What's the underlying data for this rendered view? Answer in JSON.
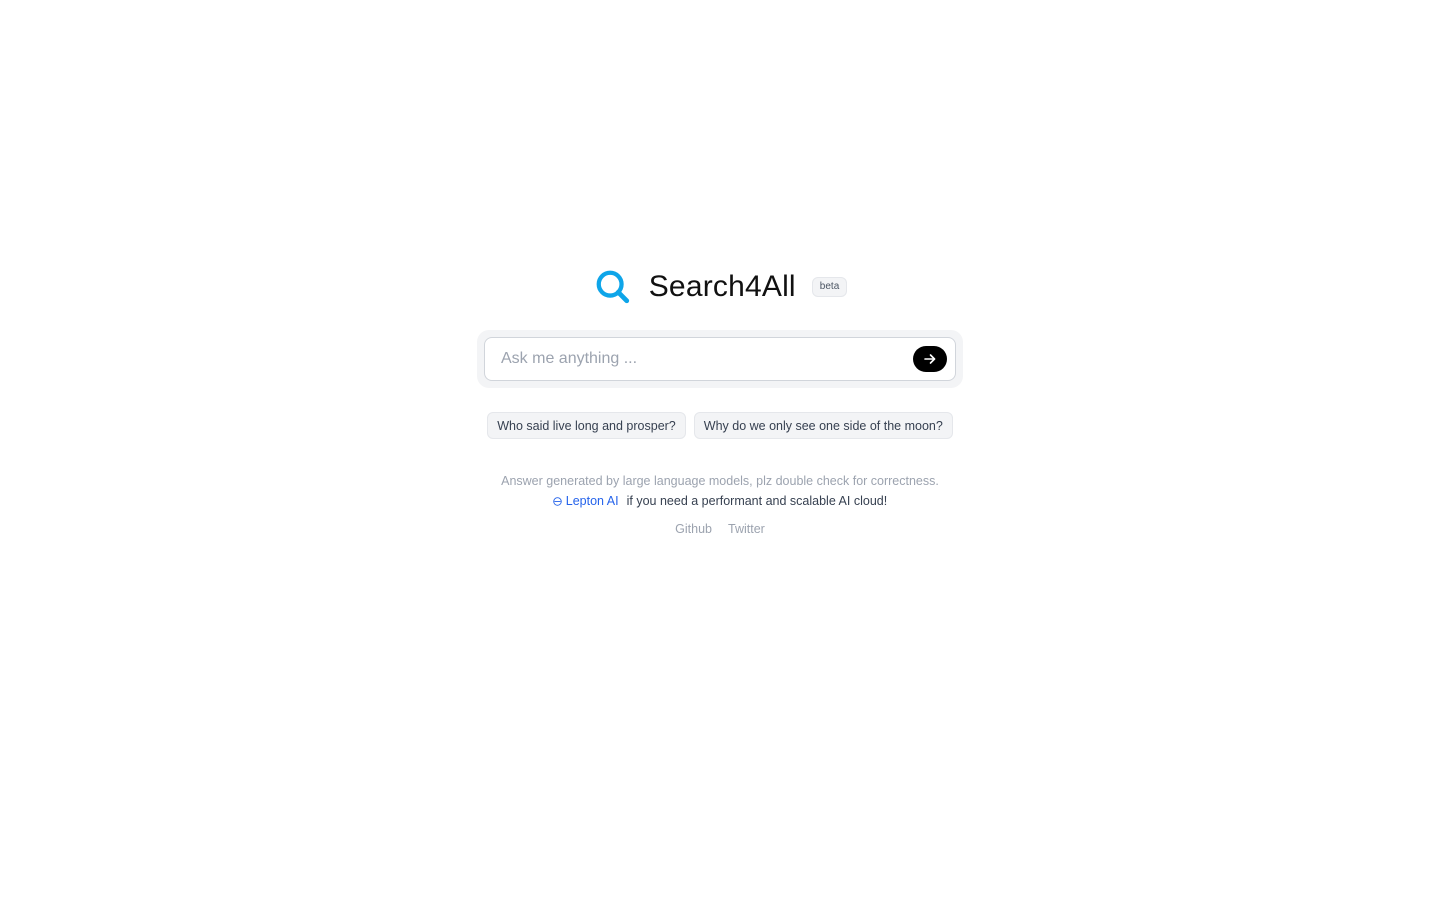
{
  "brand": {
    "title": "Search4All",
    "badge": "beta",
    "accent_color": "#0ea5e9",
    "icon": "search-icon"
  },
  "search": {
    "placeholder": "Ask me anything ...",
    "value": "",
    "submit_icon": "arrow-right-icon"
  },
  "suggestions": [
    {
      "label": "Who said live long and prosper?"
    },
    {
      "label": "Why do we only see one side of the moon?"
    }
  ],
  "footer": {
    "disclaimer": "Answer generated by large language models, plz double check for correctness.",
    "promo_link_label": "Lepton AI",
    "promo_link_icon": "lepton-logo-icon",
    "promo_text": "if you need a performant and scalable AI cloud!",
    "links": [
      {
        "label": "Github"
      },
      {
        "label": "Twitter"
      }
    ]
  }
}
